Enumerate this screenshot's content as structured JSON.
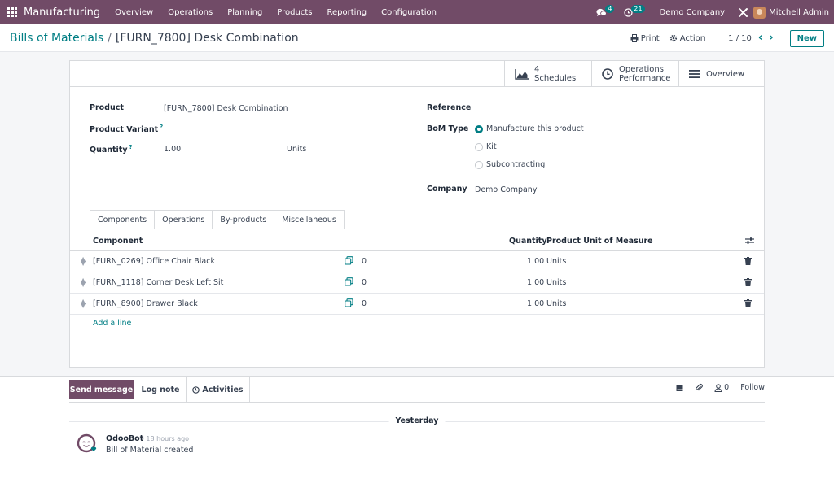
{
  "topbar": {
    "app_name": "Manufacturing",
    "menu": [
      "Overview",
      "Operations",
      "Planning",
      "Products",
      "Reporting",
      "Configuration"
    ],
    "messages_count": "4",
    "activities_count": "21",
    "company": "Demo Company",
    "user": "Mitchell Admin"
  },
  "control": {
    "breadcrumb_parent": "Bills of Materials",
    "breadcrumb_sep": "/",
    "breadcrumb_current": "[FURN_7800] Desk Combination",
    "print_label": "Print",
    "action_label": "Action",
    "pager": "1 / 10",
    "new_label": "New"
  },
  "smart_buttons": {
    "schedules_count": "4",
    "schedules_label": "Schedules",
    "operations_line1": "Operations",
    "operations_line2": "Performance",
    "overview_label": "Overview"
  },
  "form": {
    "product_label": "Product",
    "product_value": "[FURN_7800] Desk Combination",
    "variant_label": "Product Variant",
    "quantity_label": "Quantity",
    "quantity_value": "1.00",
    "quantity_uom": "Units",
    "help_mark": "?",
    "reference_label": "Reference",
    "bom_type_label": "BoM Type",
    "bom_types": [
      "Manufacture this product",
      "Kit",
      "Subcontracting"
    ],
    "bom_type_selected": 0,
    "company_label": "Company",
    "company_value": "Demo Company"
  },
  "tabs": [
    "Components",
    "Operations",
    "By-products",
    "Miscellaneous"
  ],
  "table": {
    "headers": {
      "component": "Component",
      "quantity": "Quantity",
      "uom": "Product Unit of Measure"
    },
    "rows": [
      {
        "component": "[FURN_0269] Office Chair Black",
        "forecast": "0",
        "quantity": "1.00",
        "uom": "Units"
      },
      {
        "component": "[FURN_1118] Corner Desk Left Sit",
        "forecast": "0",
        "quantity": "1.00",
        "uom": "Units"
      },
      {
        "component": "[FURN_8900] Drawer Black",
        "forecast": "0",
        "quantity": "1.00",
        "uom": "Units"
      }
    ],
    "add_line": "Add a line"
  },
  "chatter": {
    "send_message": "Send message",
    "log_note": "Log note",
    "activities": "Activities",
    "followers_count": "0",
    "follow": "Follow",
    "day_separator": "Yesterday",
    "message": {
      "author": "OdooBot",
      "time": "- 18 hours ago",
      "body": "Bill of Material created"
    }
  },
  "colors": {
    "brand": "#714B67",
    "accent": "#017E84"
  }
}
